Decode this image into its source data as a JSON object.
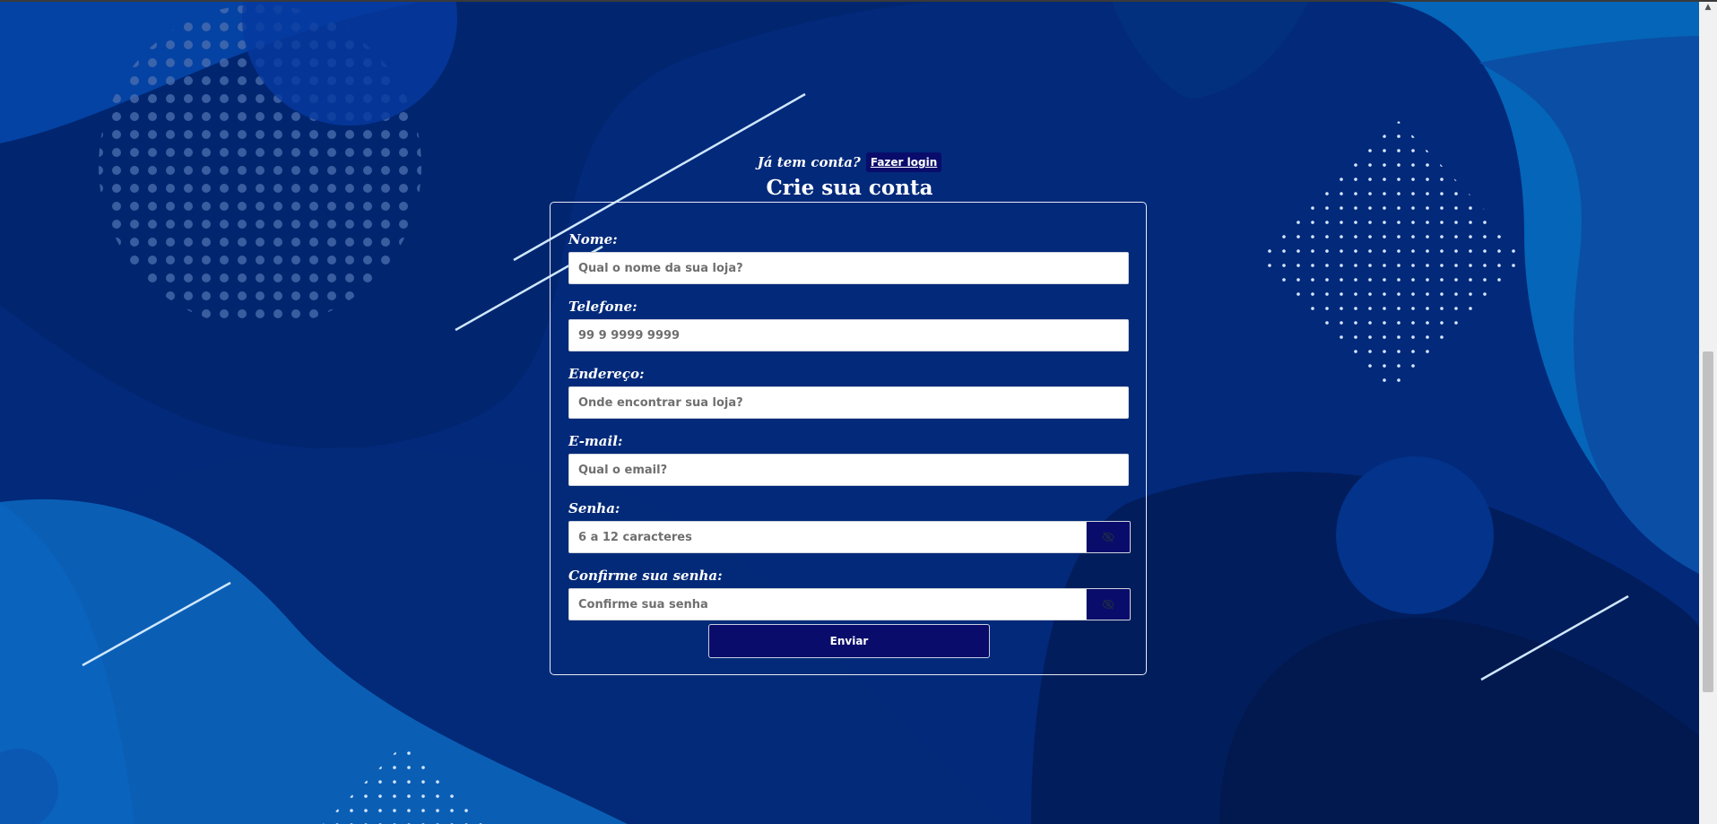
{
  "header": {
    "has_account_text": "Já tem conta?",
    "login_link_label": "Fazer login",
    "title": "Crie sua conta"
  },
  "form": {
    "fields": [
      {
        "label": "Nome:",
        "placeholder": "Qual o nome da sua loja?"
      },
      {
        "label": "Telefone:",
        "placeholder": "99 9 9999 9999"
      },
      {
        "label": "Endereço:",
        "placeholder": "Onde encontrar sua loja?"
      },
      {
        "label": "E-mail:",
        "placeholder": "Qual o email?"
      },
      {
        "label": "Senha:",
        "placeholder": "6 a 12 caracteres"
      },
      {
        "label": "Confirme sua senha:",
        "placeholder": "Confirme sua senha"
      }
    ],
    "submit_label": "Enviar"
  },
  "icons": {
    "password_toggle": "eye-slash-icon",
    "scroll_up": "chevron-up-icon"
  },
  "colors": {
    "background": "#02297a",
    "button": "#0a0c6b",
    "text": "#ffffff"
  }
}
